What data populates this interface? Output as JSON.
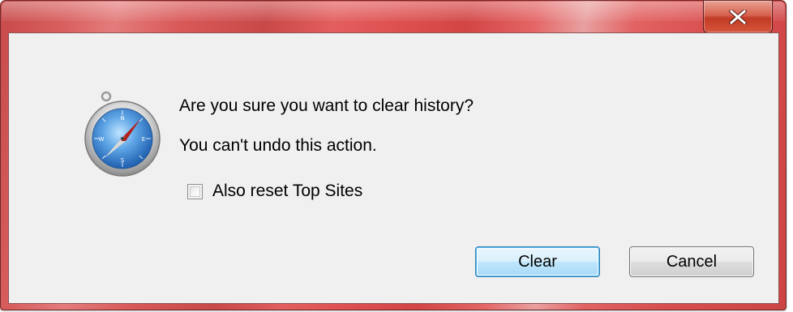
{
  "dialog": {
    "close_glyph": "x",
    "icon": "safari-compass-icon",
    "question": "Are you sure you want to clear history?",
    "warning": "You can't undo this action.",
    "checkbox_label": "Also reset Top Sites",
    "checkbox_checked": false,
    "clear_label": "Clear",
    "cancel_label": "Cancel"
  },
  "colors": {
    "frame_accent": "#d94f4f",
    "client_background": "#f0f0f0",
    "default_button_border": "#3c7fb1"
  }
}
